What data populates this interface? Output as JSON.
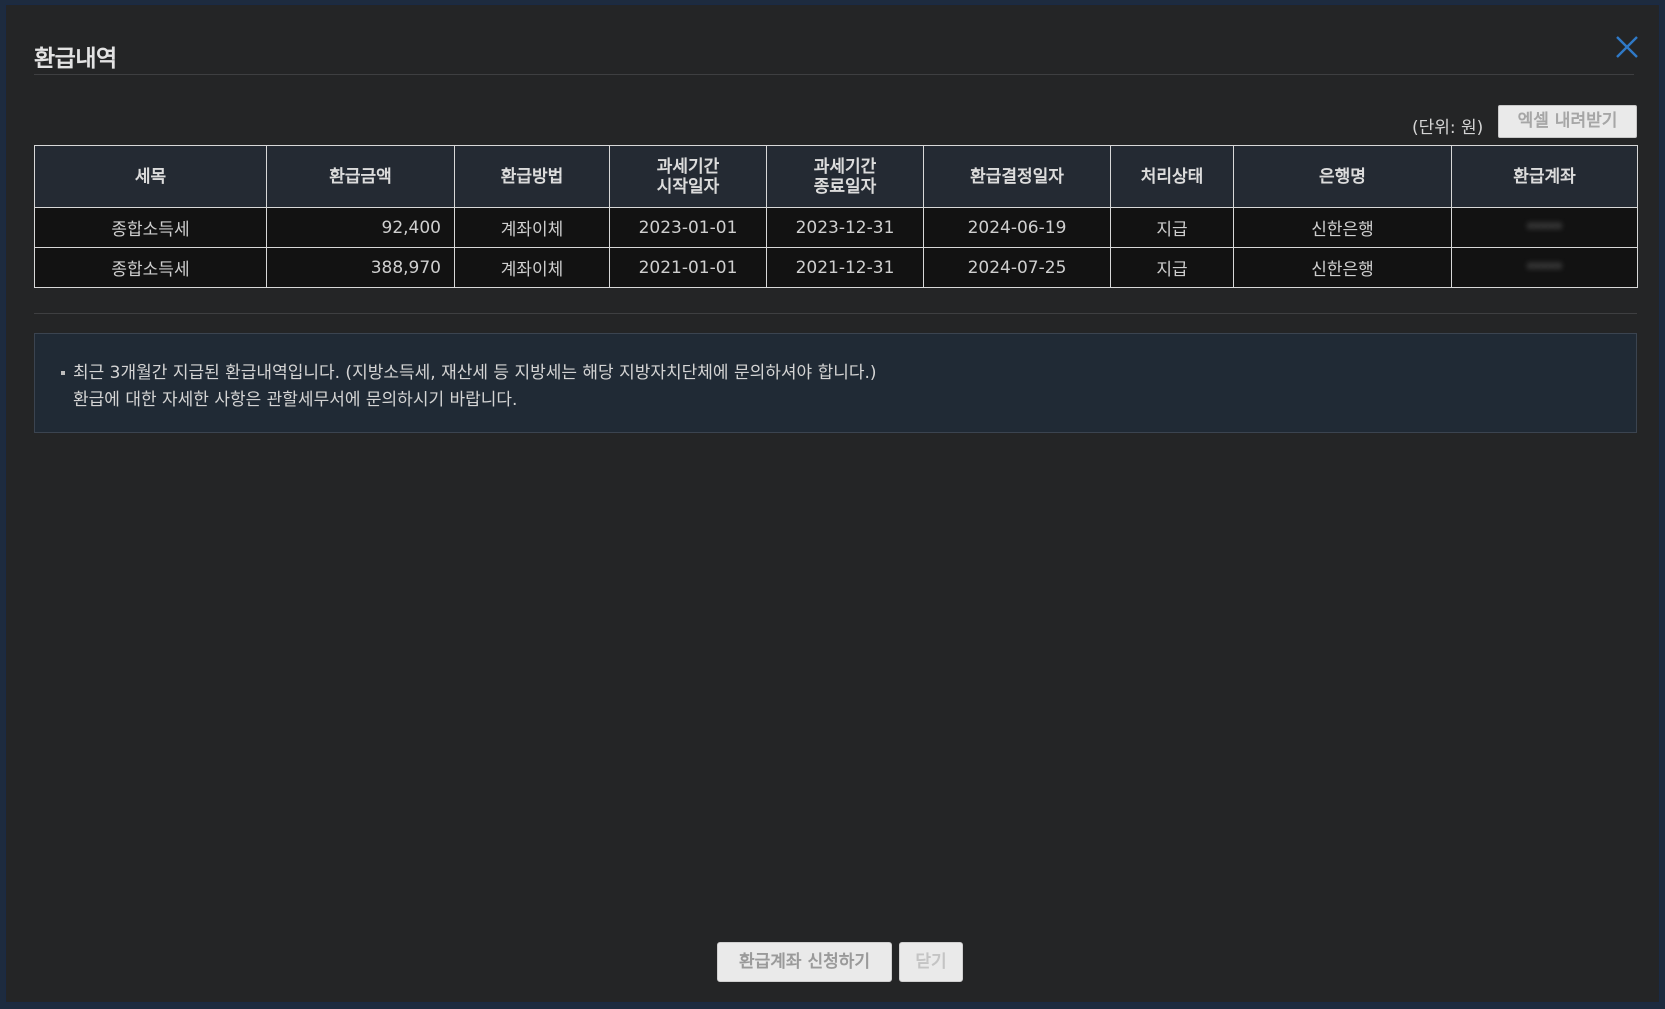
{
  "dialog": {
    "title": "환급내역"
  },
  "toolbar": {
    "unit_text": "(단위: 원)",
    "excel_label": "엑셀 내려받기"
  },
  "table": {
    "headers": [
      "세목",
      "환급금액",
      "환급방법",
      "과세기간\n시작일자",
      "과세기간\n종료일자",
      "환급결정일자",
      "처리상태",
      "은행명",
      "환급계좌"
    ],
    "rows": [
      [
        "종합소득세",
        "92,400",
        "계좌이체",
        "2023-01-01",
        "2023-12-31",
        "2024-06-19",
        "지급",
        "신한은행",
        "*****"
      ],
      [
        "종합소득세",
        "388,970",
        "계좌이체",
        "2021-01-01",
        "2021-12-31",
        "2024-07-25",
        "지급",
        "신한은행",
        "*****"
      ]
    ]
  },
  "notice": {
    "line1": "최근 3개월간 지급된 환급내역입니다. (지방소득세, 재산세 등 지방세는 해당 지방자치단체에 문의하셔야 합니다.)",
    "line2": "환급에 대한 자세한 사항은 관할세무서에 문의하시기 바랍니다."
  },
  "footer": {
    "apply_label": "환급계좌 신청하기",
    "close_label": "닫기"
  },
  "colors": {
    "close_icon": "#2f79c7",
    "panel_bg": "#242526"
  }
}
